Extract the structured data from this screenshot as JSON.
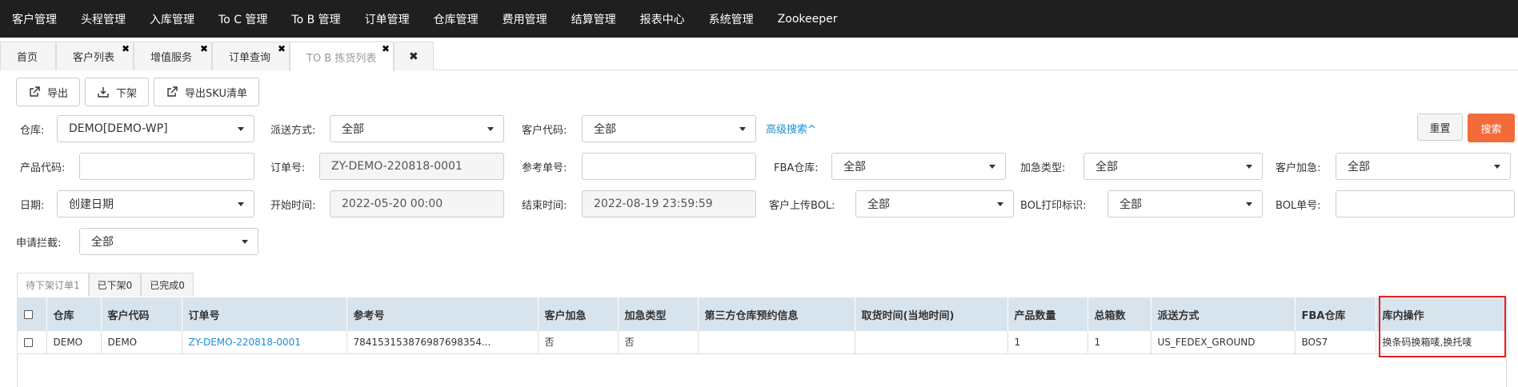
{
  "topnav": [
    "客户管理",
    "头程管理",
    "入库管理",
    "To C 管理",
    "To B 管理",
    "订单管理",
    "仓库管理",
    "费用管理",
    "结算管理",
    "报表中心",
    "系统管理",
    "Zookeeper"
  ],
  "tabs": [
    {
      "label": "首页",
      "closable": false,
      "active": false
    },
    {
      "label": "客户列表",
      "closable": true,
      "active": false
    },
    {
      "label": "增值服务",
      "closable": true,
      "active": false
    },
    {
      "label": "订单查询",
      "closable": true,
      "active": false
    },
    {
      "label": "TO B 拣货列表",
      "closable": true,
      "active": true
    }
  ],
  "close_all_glyph": "✖",
  "tab_close_glyph": "✖",
  "toolbar": {
    "export": "导出",
    "offshelf": "下架",
    "export_sku": "导出SKU清单"
  },
  "filters": {
    "warehouse_label": "仓库:",
    "warehouse_value": "DEMO[DEMO-WP]",
    "delivery_label": "派送方式:",
    "delivery_value": "全部",
    "customer_code_label": "客户代码:",
    "customer_code_value": "全部",
    "advanced_search": "高级搜索^",
    "product_code_label": "产品代码:",
    "product_code_value": "",
    "order_no_label": "订单号:",
    "order_no_value": "ZY-DEMO-220818-0001",
    "ref_no_label": "参考单号:",
    "ref_no_value": "",
    "fba_label": "FBA仓库:",
    "fba_value": "全部",
    "urgent_type_label": "加急类型:",
    "urgent_type_value": "全部",
    "customer_urgent_label": "客户加急:",
    "customer_urgent_value": "全部",
    "date_label": "日期:",
    "date_value": "创建日期",
    "start_label": "开始时间:",
    "start_value": "2022-05-20 00:00",
    "end_label": "结束时间:",
    "end_value": "2022-08-19 23:59:59",
    "bol_upload_label": "客户上传BOL:",
    "bol_upload_value": "全部",
    "bol_print_label": "BOL打印标识:",
    "bol_print_value": "全部",
    "bol_no_label": "BOL单号:",
    "bol_no_value": "",
    "intercept_label": "申请拦截:",
    "intercept_value": "全部",
    "reset": "重置",
    "search": "搜索"
  },
  "status_tabs": [
    "待下架订单1",
    "已下架0",
    "已完成0"
  ],
  "table": {
    "headers": [
      "仓库",
      "客户代码",
      "订单号",
      "参考号",
      "客户加急",
      "加急类型",
      "第三方仓库预约信息",
      "取货时间(当地时间)",
      "产品数量",
      "总箱数",
      "派送方式",
      "FBA仓库",
      "库内操作"
    ],
    "rows": [
      [
        "DEMO",
        "DEMO",
        "ZY-DEMO-220818-0001",
        "784153153876987698354...",
        "否",
        "否",
        "",
        "",
        "1",
        "1",
        "US_FEDEX_GROUND",
        "BOS7",
        "换条码换箱唛,换托唛"
      ]
    ]
  },
  "colors": {
    "topnav_bg": "#1f1f1f",
    "search_button": "#f26b38",
    "link": "#1a8fd6",
    "header_row": "#d8e4ed",
    "highlight": "#e62020"
  }
}
